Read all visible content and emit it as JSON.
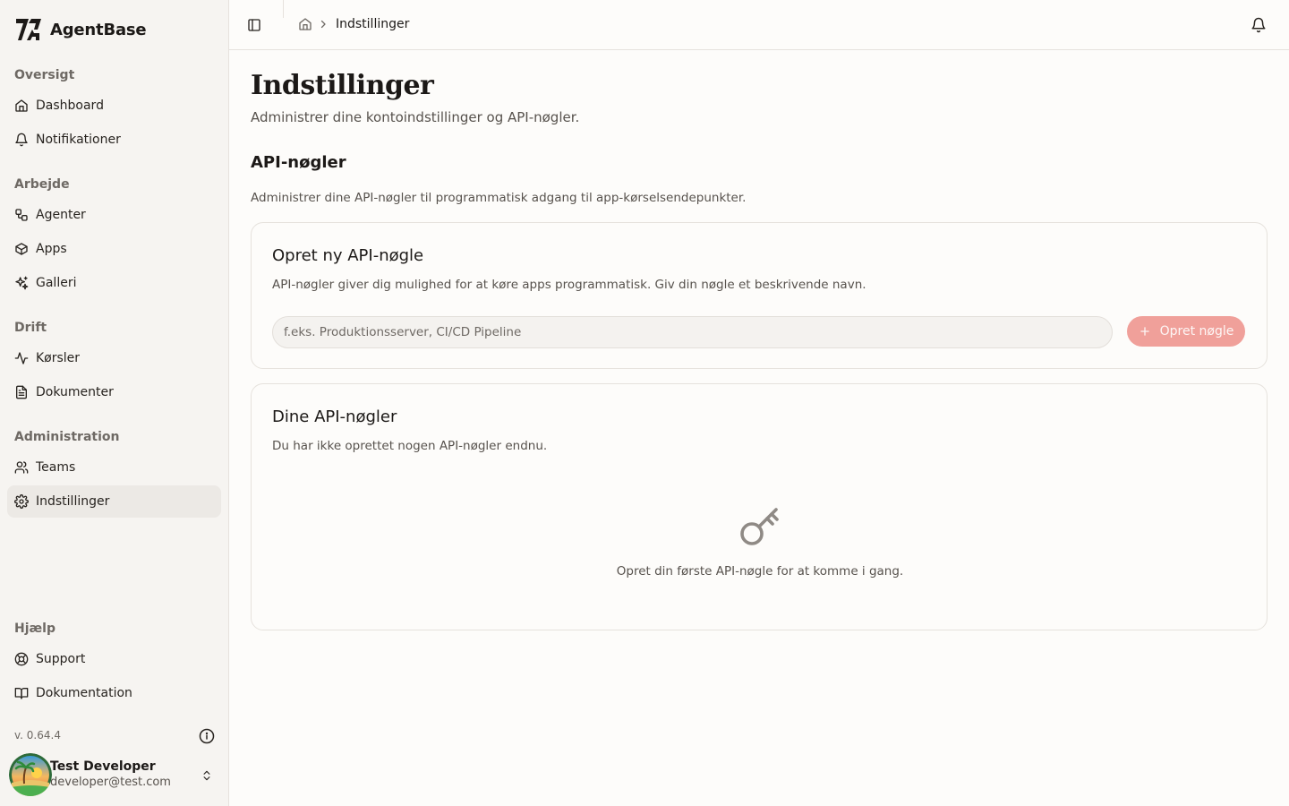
{
  "app": {
    "name": "AgentBase"
  },
  "sidebar": {
    "sections": [
      {
        "heading": "Oversigt",
        "items": [
          {
            "label": "Dashboard",
            "icon": "home-icon"
          },
          {
            "label": "Notifikationer",
            "icon": "bell-icon"
          }
        ]
      },
      {
        "heading": "Arbejde",
        "items": [
          {
            "label": "Agenter",
            "icon": "workflow-icon"
          },
          {
            "label": "Apps",
            "icon": "box-icon"
          },
          {
            "label": "Galleri",
            "icon": "sparkles-icon"
          }
        ]
      },
      {
        "heading": "Drift",
        "items": [
          {
            "label": "Kørsler",
            "icon": "activity-icon"
          },
          {
            "label": "Dokumenter",
            "icon": "file-text-icon"
          }
        ]
      },
      {
        "heading": "Administration",
        "items": [
          {
            "label": "Teams",
            "icon": "users-icon"
          },
          {
            "label": "Indstillinger",
            "icon": "settings-icon",
            "active": true
          }
        ]
      },
      {
        "heading": "Hjælp",
        "items": [
          {
            "label": "Support",
            "icon": "life-buoy-icon"
          },
          {
            "label": "Dokumentation",
            "icon": "book-open-icon"
          }
        ]
      }
    ],
    "version": "v. 0.64.4",
    "user": {
      "name": "Test Developer",
      "email": "developer@test.com"
    }
  },
  "topbar": {
    "breadcrumb_current": "Indstillinger"
  },
  "main": {
    "title": "Indstillinger",
    "subtitle": "Administrer dine kontoindstillinger og API-nøgler.",
    "section_title": "API-nøgler",
    "section_desc": "Administrer dine API-nøgler til programmatisk adgang til app-kørselsendepunkter.",
    "create_card": {
      "title": "Opret ny API-nøgle",
      "desc": "API-nøgler giver dig mulighed for at køre apps programmatisk. Giv din nøgle et beskrivende navn.",
      "input_placeholder": "f.eks. Produktionsserver, CI/CD Pipeline",
      "input_value": "",
      "button_label": "Opret nøgle"
    },
    "list_card": {
      "title": "Dine API-nøgler",
      "desc": "Du har ikke oprettet nogen API-nøgler endnu.",
      "empty_text": "Opret din første API-nøgle for at komme i gang."
    }
  },
  "colors": {
    "accent": "#f0a09a",
    "sidebar_bg": "#f6f4f1",
    "active_bg": "#ece9e5"
  }
}
